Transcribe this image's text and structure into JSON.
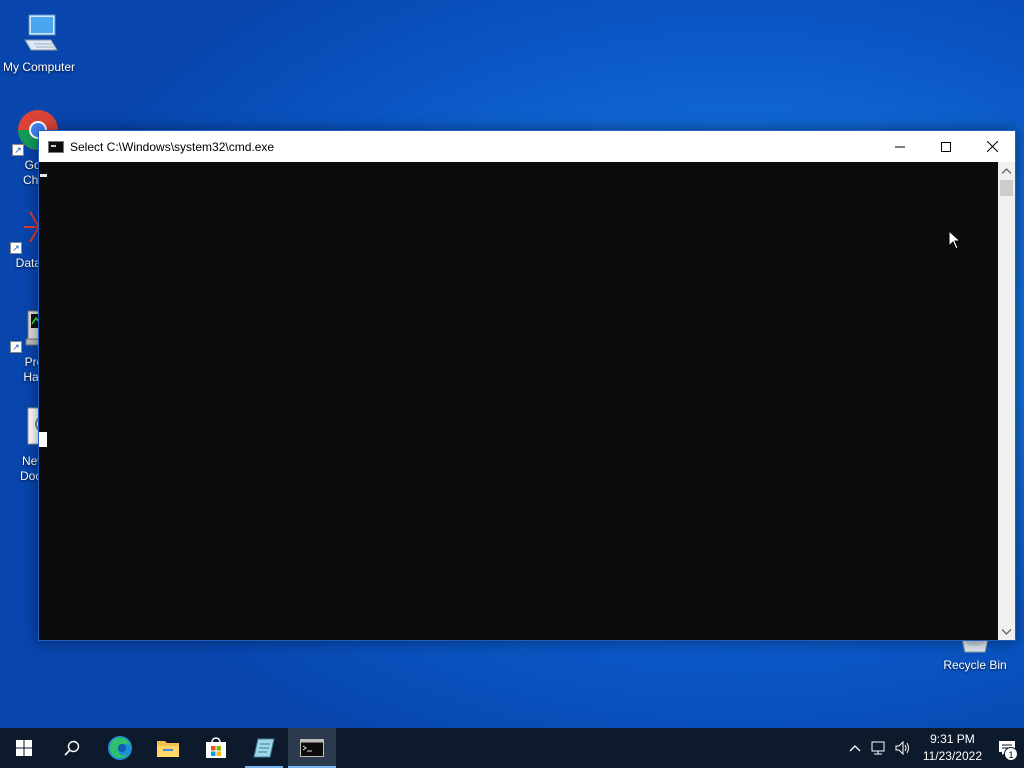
{
  "desktop": {
    "icons": [
      {
        "label": "My Computer"
      },
      {
        "label": "Goo\nChro"
      },
      {
        "label": "DataW"
      },
      {
        "label": "Pro\nHac"
      },
      {
        "label": "New\nDocu"
      },
      {
        "label": "Recycle Bin"
      }
    ]
  },
  "cmd_window": {
    "title": "Select C:\\Windows\\system32\\cmd.exe",
    "minimize_glyph": "—",
    "maximize_glyph": "☐",
    "close_glyph": "✕"
  },
  "taskbar": {
    "apps": [
      "start",
      "search",
      "edge",
      "file-explorer",
      "microsoft-store",
      "notepad-app",
      "command-prompt"
    ],
    "clock": {
      "time": "9:31 PM",
      "date": "11/23/2022"
    },
    "notification_count": "1"
  },
  "colors": {
    "desktop_accent": "#1470dc",
    "taskbar_bg": "#0d1a2c",
    "console_bg": "#0c0c0c",
    "taskbar_indicator": "#78b4ef"
  }
}
